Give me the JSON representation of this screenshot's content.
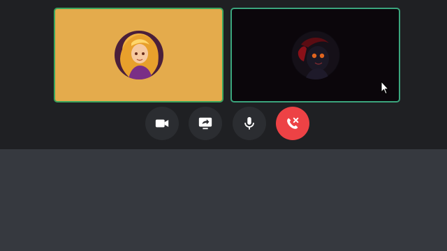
{
  "participants": [
    {
      "id": "user-1",
      "speaking": true,
      "tile_color": "#e4ab4c"
    },
    {
      "id": "user-2",
      "speaking": true,
      "tile_color": "#0b060b"
    }
  ],
  "controls": [
    {
      "name": "camera",
      "icon": "video-camera-icon"
    },
    {
      "name": "screen-share",
      "icon": "screen-share-icon"
    },
    {
      "name": "microphone",
      "icon": "microphone-icon"
    },
    {
      "name": "disconnect",
      "icon": "phone-hangup-icon",
      "color": "#ed4245"
    }
  ],
  "colors": {
    "call_background": "#1f2023",
    "lower_background": "#36393f",
    "speaking_border": "#3ba55d",
    "button_background": "#2b2d31"
  }
}
